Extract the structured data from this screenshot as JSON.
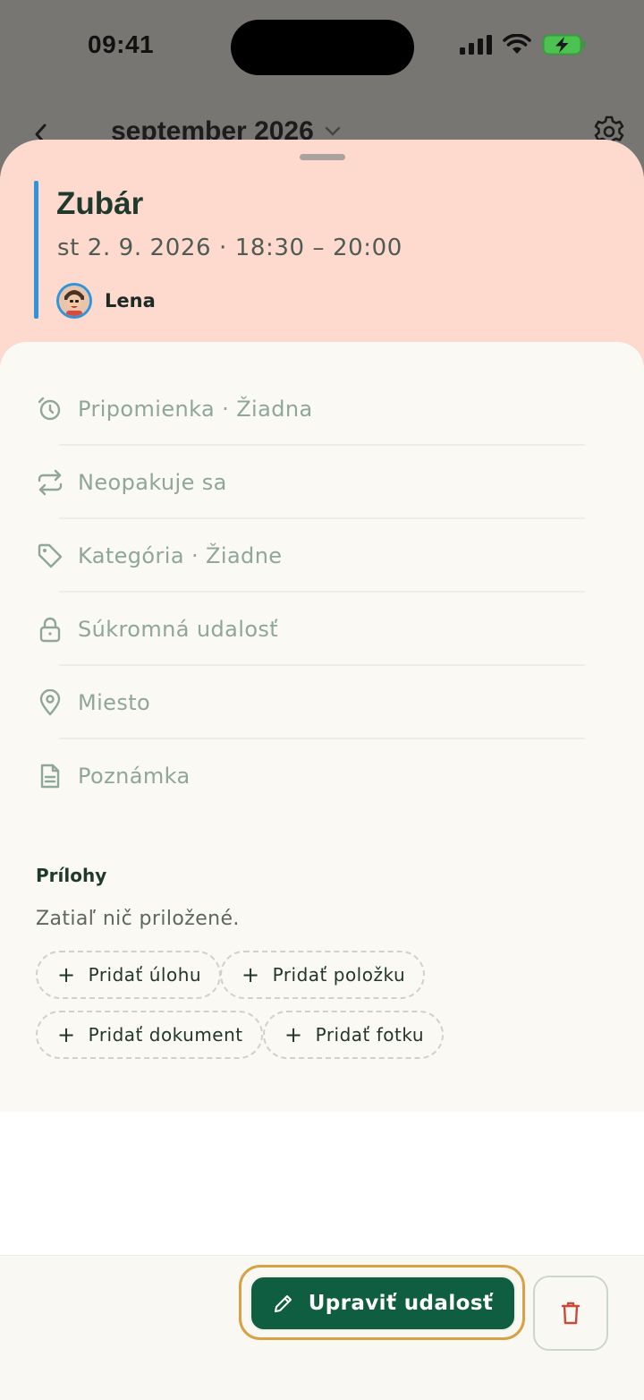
{
  "status_bar": {
    "time": "09:41"
  },
  "header": {
    "month": "september 2026"
  },
  "event": {
    "title": "Zubár",
    "datetime": "st 2. 9. 2026 · 18:30 – 20:00",
    "person": "Lena",
    "accent_color": "#2e95dc",
    "header_color": "#fdd9ce"
  },
  "details": {
    "rows": [
      {
        "icon": "alarm-icon",
        "label": "Pripomienka · Žiadna"
      },
      {
        "icon": "repeat-icon",
        "label": "Neopakuje sa"
      },
      {
        "icon": "tag-icon",
        "label": "Kategória · Žiadne"
      },
      {
        "icon": "lock-icon",
        "label": "Súkromná udalosť"
      },
      {
        "icon": "location-pin-icon",
        "label": "Miesto"
      },
      {
        "icon": "document-icon",
        "label": "Poznámka"
      }
    ]
  },
  "attachments": {
    "title": "Prílohy",
    "empty_text": "Zatiaľ nič priložené.",
    "chips": [
      {
        "label": "Pridať úlohu"
      },
      {
        "label": "Pridať položku"
      },
      {
        "label": "Pridať dokument"
      },
      {
        "label": "Pridať fotku"
      }
    ]
  },
  "actions": {
    "edit_label": "Upraviť udalosť",
    "edit_color": "#0f5e42",
    "delete_icon": "trash-icon",
    "delete_color": "#c94a3a"
  }
}
